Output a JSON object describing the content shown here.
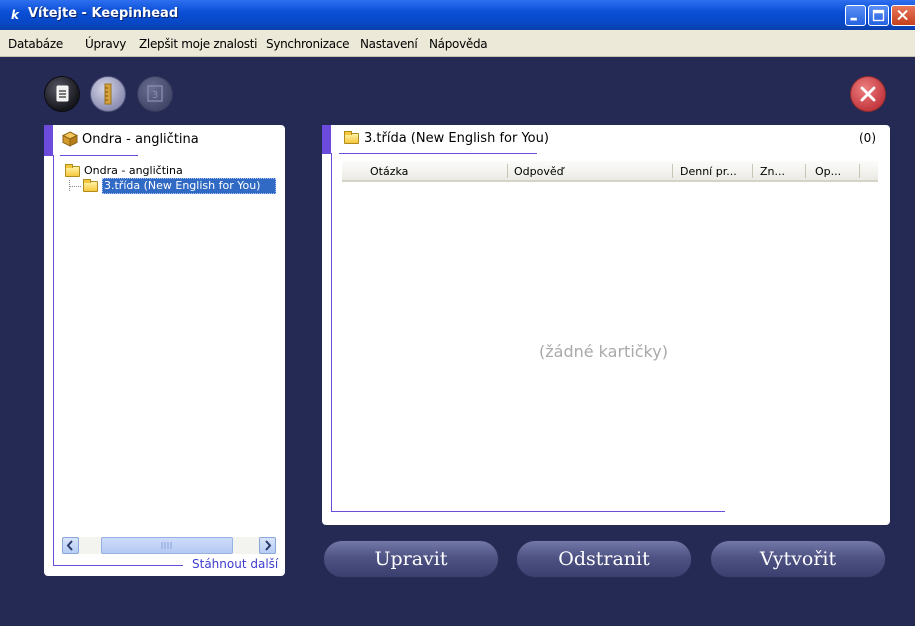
{
  "window": {
    "icon_letter": "k",
    "title": "Vítejte - Keepinhead",
    "controls": [
      "minimize-icon",
      "maximize-icon",
      "close-icon"
    ]
  },
  "menu": {
    "items": [
      "Databáze",
      "Úpravy",
      "Zlepšit moje znalosti",
      "Synchronizace",
      "Nastavení",
      "Nápověda"
    ]
  },
  "toolbar": {
    "buttons": [
      "document-icon",
      "ruler-icon",
      "calendar-icon"
    ],
    "close_button": "close-icon"
  },
  "left_panel": {
    "title": "Ondra - angličtina",
    "tree": {
      "root_label": "Ondra - angličtina",
      "child_label": "3.třída (New English for You)"
    },
    "download_link": "Stáhnout další"
  },
  "right_panel": {
    "title": "3.třída (New English for You)",
    "count": "(0)",
    "columns": [
      "Otázka",
      "Odpověď",
      "Denní pr...",
      "Zn...",
      "Op..."
    ],
    "empty_text": "(žádné kartičky)"
  },
  "actions": {
    "edit": "Upravit",
    "remove": "Odstranit",
    "create": "Vytvořit"
  },
  "colors": {
    "background": "#242a54",
    "accent": "#6a4bdc",
    "selection": "#316ac5",
    "titlebar": "#0a4fd6"
  }
}
